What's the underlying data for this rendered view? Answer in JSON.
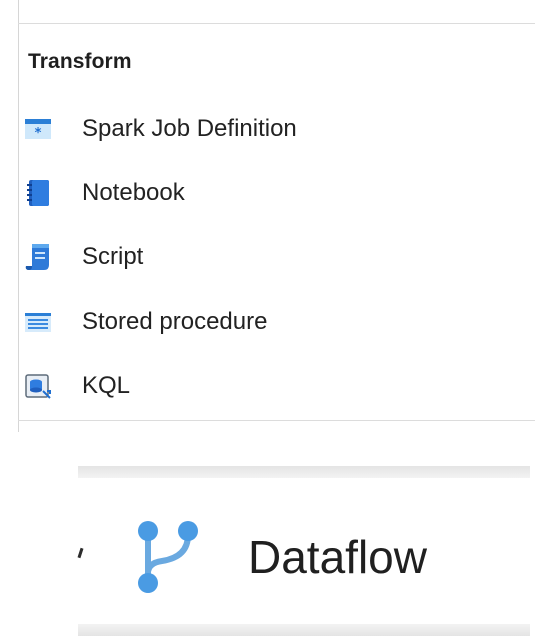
{
  "transform": {
    "title": "Transform",
    "items": [
      {
        "label": "Spark Job Definition",
        "icon": "spark-job-icon"
      },
      {
        "label": "Notebook",
        "icon": "notebook-icon"
      },
      {
        "label": "Script",
        "icon": "script-icon"
      },
      {
        "label": "Stored procedure",
        "icon": "stored-procedure-icon"
      },
      {
        "label": "KQL",
        "icon": "kql-icon"
      }
    ]
  },
  "dataflow": {
    "label": "Dataflow",
    "icon": "dataflow-icon"
  },
  "colors": {
    "icon_blue": "#1f6fd1",
    "icon_light_blue": "#5fb4f0",
    "dataflow_blue": "#4a9be3"
  }
}
